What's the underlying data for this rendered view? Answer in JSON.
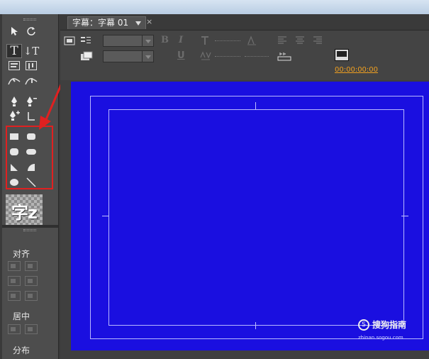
{
  "title_tab": {
    "label": "字幕：字幕 01",
    "close_glyph": "×"
  },
  "toolbar": {
    "bold_glyph": "B",
    "italic_glyph": "I",
    "underline_glyph": "U",
    "timecode": "00:00:00:00"
  },
  "tools": {
    "text_glyph": "T",
    "vtext_glyph": "↓T"
  },
  "preview": {
    "sample_text": "字z"
  },
  "panel": {
    "align_label": "对齐",
    "center_label": "居中",
    "distribute_label": "分布"
  },
  "watermark": {
    "text": "搜狗指南",
    "sub": "zhinan.sogou.com",
    "logo_glyph": "S"
  },
  "colors": {
    "canvas": "#1a0fe0",
    "highlight": "#e02020",
    "timecode": "#f0a020"
  }
}
